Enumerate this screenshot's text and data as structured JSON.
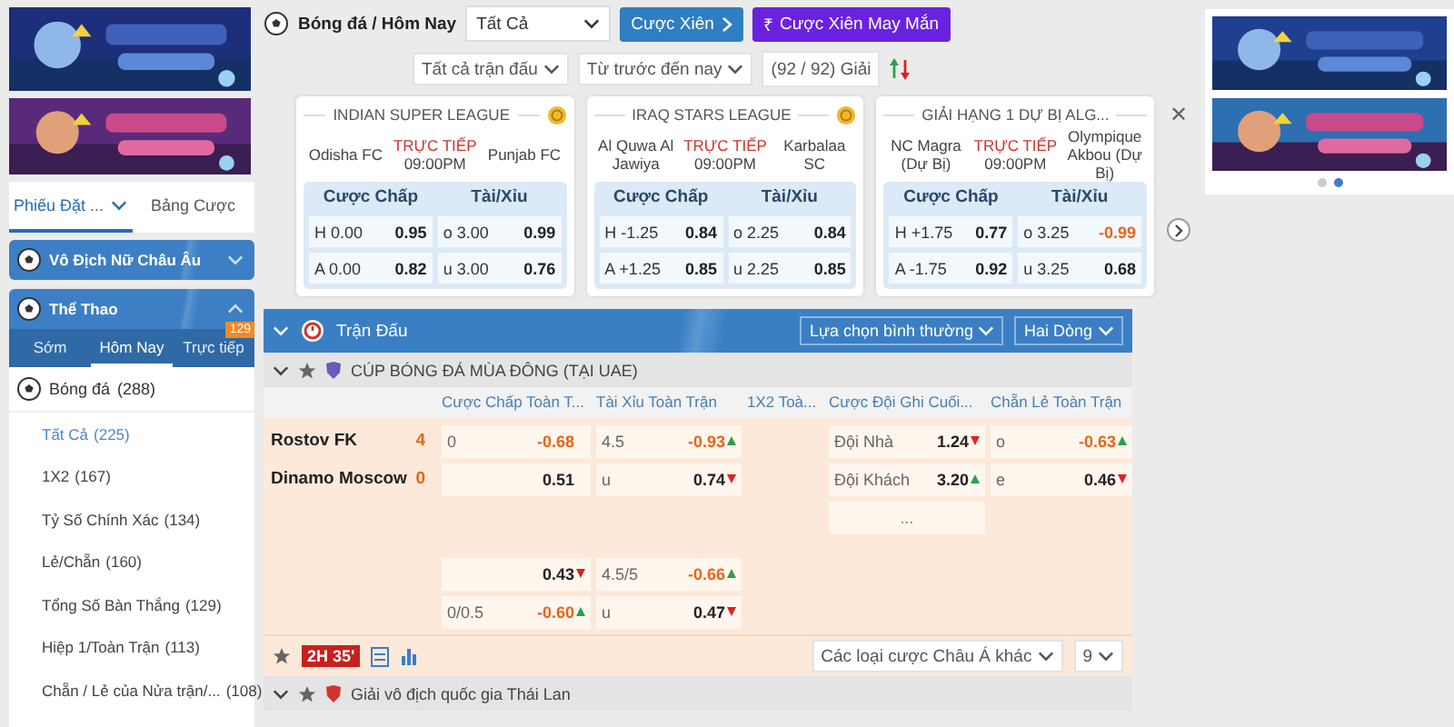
{
  "left": {
    "tabs": [
      {
        "label": "Phiếu Đặt ...",
        "selected": true,
        "dropdown": true
      },
      {
        "label": "Bảng Cược",
        "selected": false,
        "dropdown": false
      }
    ],
    "promo_header": {
      "label": "Vô Địch Nữ Châu Âu",
      "expanded": false
    },
    "sports_header": {
      "label": "Thể Thao",
      "expanded": true
    },
    "periods": [
      {
        "label": "Sớm",
        "selected": false
      },
      {
        "label": "Hôm Nay",
        "selected": true
      },
      {
        "label": "Trực tiếp",
        "selected": false,
        "badge": "129"
      }
    ],
    "sport": {
      "label": "Bóng đá",
      "count": "(288)"
    },
    "markets": [
      {
        "label": "Tất Cả",
        "count": "(225)",
        "selected": true
      },
      {
        "label": "1X2",
        "count": "(167)",
        "selected": false
      },
      {
        "label": "Tỷ Số Chính Xác",
        "count": "(134)",
        "selected": false
      },
      {
        "label": "Lẻ/Chẵn",
        "count": "(160)",
        "selected": false
      },
      {
        "label": "Tổng Số Bàn Thắng",
        "count": "(129)",
        "selected": false
      },
      {
        "label": "Hiệp 1/Toàn Trận",
        "count": "(113)",
        "selected": false
      },
      {
        "label": "Chẵn / Lẻ của Nửa trận/...",
        "count": "(108)",
        "selected": false
      }
    ]
  },
  "toolbar": {
    "breadcrumb": "Bóng đá / Hôm Nay",
    "select": "Tất Cả",
    "parlay_button": "Cược Xiên",
    "lucky_button": {
      "icon": "₹",
      "label": "Cược Xiên May Mắn"
    },
    "filters": [
      "Tất cả trận đấu",
      "Từ trước đến nay"
    ],
    "league_count": "(92 / 92) Giải",
    "close": "✕"
  },
  "featured": [
    {
      "league": "INDIAN SUPER LEAGUE",
      "coin": true,
      "home": "Odisha FC",
      "away": "Punjab FC",
      "status": "TRỰC TIẾP",
      "time": "09:00PM",
      "headers": [
        "Cược Chấp",
        "Tài/Xỉu"
      ],
      "rows": [
        [
          {
            "label": "H 0.00",
            "value": "0.95",
            "negative": false
          },
          {
            "label": "o 3.00",
            "value": "0.99",
            "negative": false
          }
        ],
        [
          {
            "label": "A 0.00",
            "value": "0.82",
            "negative": false
          },
          {
            "label": "u 3.00",
            "value": "0.76",
            "negative": false
          }
        ]
      ]
    },
    {
      "league": "IRAQ STARS LEAGUE",
      "coin": true,
      "home": "Al Quwa Al Jawiya",
      "away": "Karbalaa SC",
      "status": "TRỰC TIẾP",
      "time": "09:00PM",
      "headers": [
        "Cược Chấp",
        "Tài/Xỉu"
      ],
      "rows": [
        [
          {
            "label": "H -1.25",
            "value": "0.84",
            "negative": false
          },
          {
            "label": "o 2.25",
            "value": "0.84",
            "negative": false
          }
        ],
        [
          {
            "label": "A +1.25",
            "value": "0.85",
            "negative": false
          },
          {
            "label": "u 2.25",
            "value": "0.85",
            "negative": false
          }
        ]
      ]
    },
    {
      "league": "GIẢI HẠNG 1 DỰ BỊ ALG...",
      "coin": false,
      "home": "NC Magra (Dự Bị)",
      "away": "Olympique Akbou (Dự Bị)",
      "status": "TRỰC TIẾP",
      "time": "09:00PM",
      "headers": [
        "Cược Chấp",
        "Tài/Xỉu"
      ],
      "rows": [
        [
          {
            "label": "H +1.75",
            "value": "0.77",
            "negative": false
          },
          {
            "label": "o 3.25",
            "value": "-0.99",
            "negative": true
          }
        ],
        [
          {
            "label": "A -1.75",
            "value": "0.92",
            "negative": false
          },
          {
            "label": "u 3.25",
            "value": "0.68",
            "negative": false
          }
        ]
      ]
    }
  ],
  "matches": {
    "title": "Trận Đấu",
    "sort_button": "Lựa chọn bình thường",
    "lines_button": "Hai Dòng",
    "league": "CÚP BÓNG ĐÁ MÙA ĐÔNG (TẠI UAE)",
    "columns": [
      "Cược Chấp Toàn T...",
      "Tài Xỉu Toàn Trận",
      "1X2 Toà...",
      "Cược Đội Ghi Cuối...",
      "Chẵn Lẻ Toàn Trận"
    ],
    "teams": [
      {
        "name": "Rostov FK",
        "score": "4"
      },
      {
        "name": "Dinamo Moscow",
        "score": "0"
      }
    ],
    "groups": [
      {
        "rows": [
          {
            "cells": [
              {
                "kind": "odds",
                "label": "0",
                "value": "-0.68",
                "negative": true
              },
              {
                "kind": "odds",
                "label": "4.5",
                "value": "-0.93",
                "negative": true,
                "rising": true
              },
              {
                "kind": "empty"
              },
              {
                "kind": "odds",
                "label": "Đội Nhà",
                "value": "1.24",
                "negative": false,
                "rising": false
              },
              {
                "kind": "odds",
                "label": "o",
                "value": "-0.63",
                "negative": true,
                "rising": true
              }
            ]
          },
          {
            "cells": [
              {
                "kind": "odds",
                "value": "0.51",
                "negative": false
              },
              {
                "kind": "odds",
                "label": "u",
                "value": "0.74",
                "negative": false,
                "rising": false
              },
              {
                "kind": "empty"
              },
              {
                "kind": "odds",
                "label": "Đội Khách",
                "value": "3.20",
                "negative": false,
                "rising": true
              },
              {
                "kind": "odds",
                "label": "e",
                "value": "0.46",
                "negative": false,
                "rising": false
              }
            ]
          },
          {
            "cells": [
              {
                "kind": "empty"
              },
              {
                "kind": "empty"
              },
              {
                "kind": "empty"
              },
              {
                "kind": "more",
                "label": "..."
              },
              {
                "kind": "empty"
              }
            ]
          }
        ]
      },
      {
        "rows": [
          {
            "cells": [
              {
                "kind": "odds",
                "value": "0.43",
                "negative": false,
                "rising": false
              },
              {
                "kind": "odds",
                "label": "4.5/5",
                "value": "-0.66",
                "negative": true,
                "rising": true
              },
              {
                "kind": "empty"
              },
              {
                "kind": "empty"
              },
              {
                "kind": "empty"
              }
            ]
          },
          {
            "cells": [
              {
                "kind": "odds",
                "label": "0/0.5",
                "value": "-0.60",
                "negative": true,
                "rising": true
              },
              {
                "kind": "odds",
                "label": "u",
                "value": "0.47",
                "negative": false,
                "rising": false
              },
              {
                "kind": "empty"
              },
              {
                "kind": "empty"
              },
              {
                "kind": "empty"
              }
            ]
          }
        ]
      }
    ],
    "live_time": "2H 35'",
    "other_bets": "Các loại cược Châu Á khác",
    "more_count": "9",
    "next_league": "Giải vô địch quốc gia Thái Lan"
  }
}
